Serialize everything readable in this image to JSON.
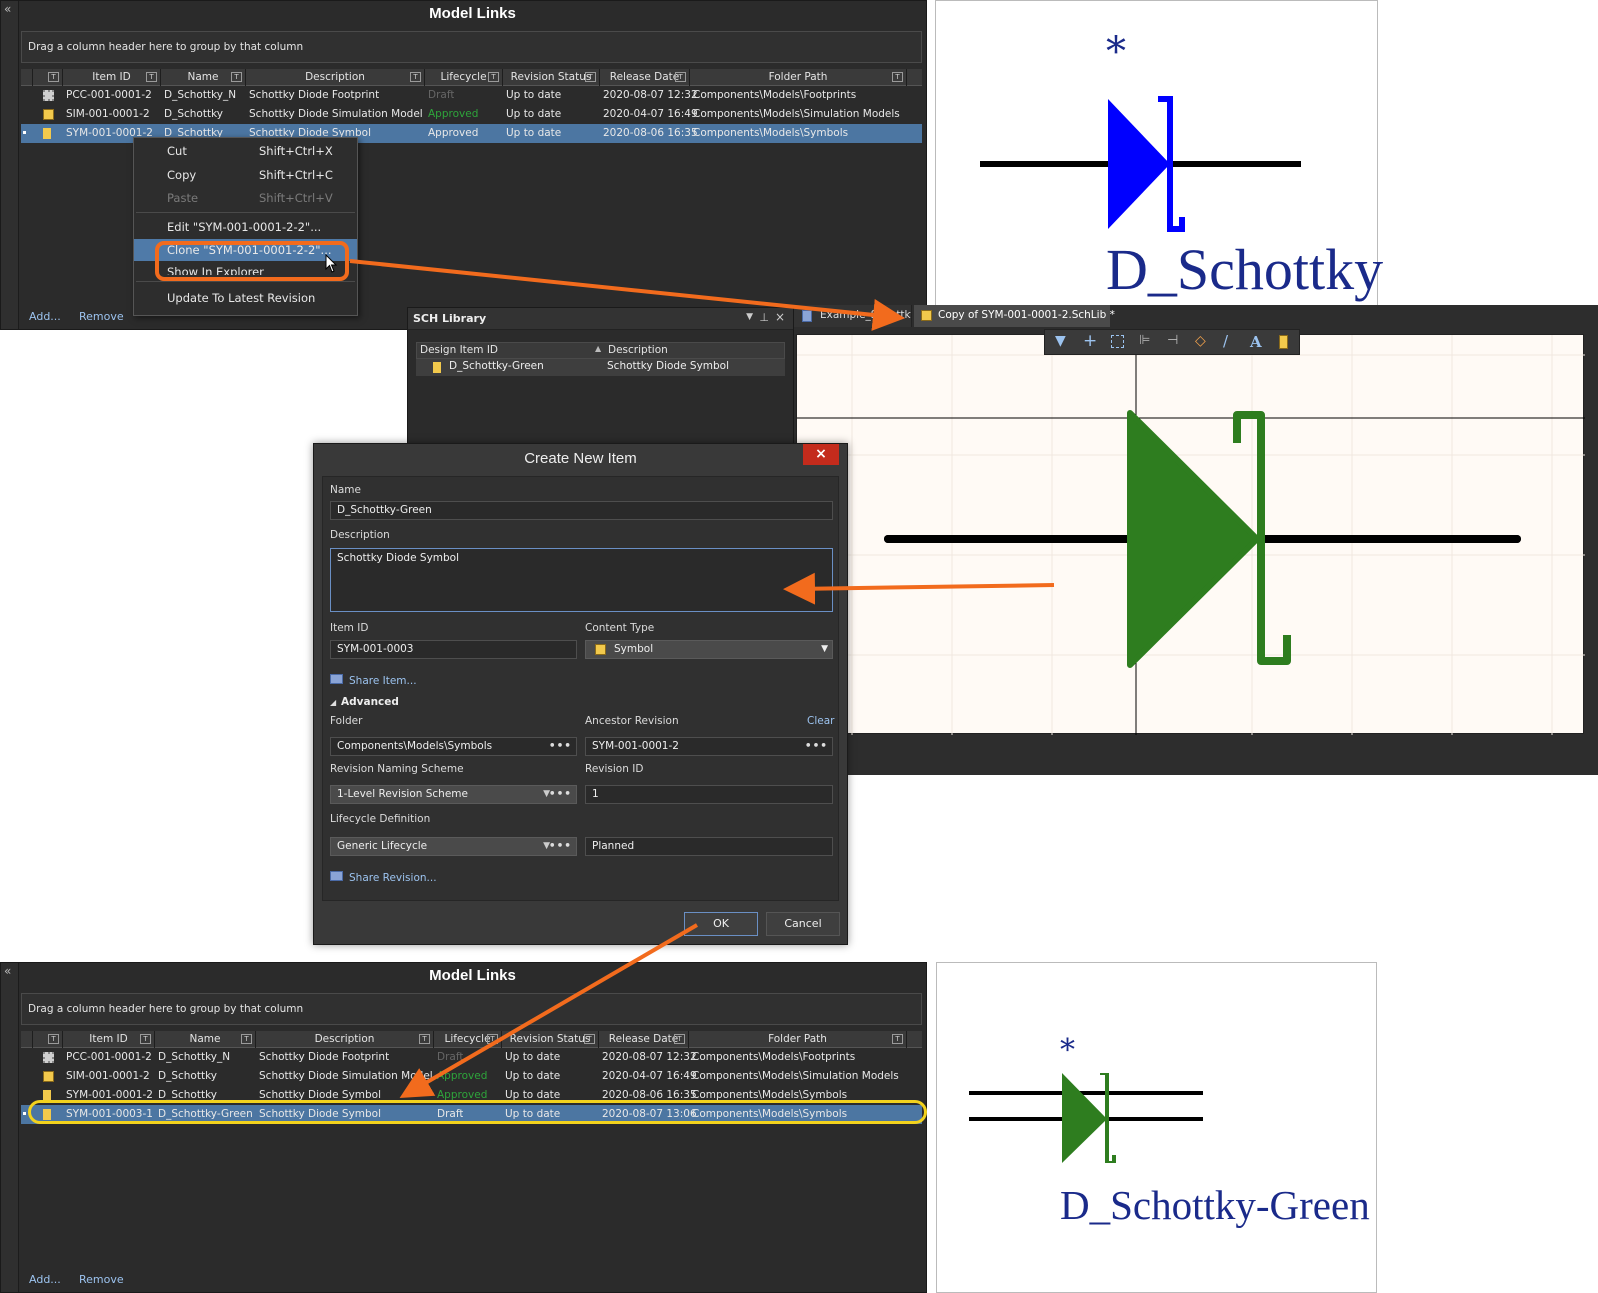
{
  "top_panel": {
    "title": "Model Links",
    "group_hint": "Drag a column header here to group by that column",
    "columns": [
      "Item ID",
      "Name",
      "Description",
      "Lifecycle",
      "Revision Status",
      "Release Date",
      "Folder Path"
    ],
    "rows": [
      {
        "icon": "footprint-icon",
        "item_id": "PCC-001-0001-2",
        "name": "D_Schottky_N",
        "description": "Schottky Diode Footprint",
        "lifecycle": "Draft",
        "revision_status": "Up to date",
        "release_date": "2020-08-07 12:32",
        "folder": "Components\\Models\\Footprints"
      },
      {
        "icon": "simulation-icon",
        "item_id": "SIM-001-0001-2",
        "name": "D_Schottky",
        "description": "Schottky Diode Simulation Model",
        "lifecycle": "Approved",
        "revision_status": "Up to date",
        "release_date": "2020-04-07 16:49",
        "folder": "Components\\Models\\Simulation Models"
      },
      {
        "icon": "symbol-icon",
        "item_id": "SYM-001-0001-2",
        "name": "D_Schottky",
        "description": "Schottky Diode Symbol",
        "lifecycle": "Approved",
        "revision_status": "Up to date",
        "release_date": "2020-08-06 16:35",
        "folder": "Components\\Models\\Symbols"
      }
    ],
    "add_label": "Add...",
    "remove_label": "Remove"
  },
  "context_menu": {
    "cut": "Cut",
    "cut_sc": "Shift+Ctrl+X",
    "copy": "Copy",
    "copy_sc": "Shift+Ctrl+C",
    "paste": "Paste",
    "paste_sc": "Shift+Ctrl+V",
    "edit": "Edit \"SYM-001-0001-2-2\"...",
    "clone": "Clone \"SYM-001-0001-2-2\"...",
    "show_explorer": "Show In Explorer",
    "update": "Update To Latest Revision"
  },
  "top_symbol": {
    "designator": "*",
    "name": "D_Schottky",
    "color": "#0000ff"
  },
  "sch_library": {
    "title": "SCH Library",
    "col_id": "Design Item ID",
    "col_desc": "Description",
    "item_id": "D_Schottky-Green",
    "item_desc": "Schottky Diode Symbol"
  },
  "editor": {
    "tab1": "Example_Schottky",
    "tab2": "Copy of SYM-001-0001-2.SchLib *",
    "symbol_color": "#2e7d1f"
  },
  "dialog": {
    "title": "Create New Item",
    "close": "×",
    "name_label": "Name",
    "name_value": "D_Schottky-Green",
    "desc_label": "Description",
    "desc_value": "Schottky Diode Symbol",
    "item_id_label": "Item ID",
    "item_id_value": "SYM-001-0003",
    "content_type_label": "Content Type",
    "content_type_value": "Symbol",
    "share_item": "Share Item...",
    "advanced": "Advanced",
    "folder_label": "Folder",
    "folder_value": "Components\\Models\\Symbols",
    "ancestor_label": "Ancestor Revision",
    "ancestor_value": "SYM-001-0001-2",
    "clear": "Clear",
    "naming_label": "Revision Naming Scheme",
    "naming_value": "1-Level Revision Scheme",
    "rev_id_label": "Revision ID",
    "rev_id_value": "1",
    "lifecycle_label": "Lifecycle Definition",
    "lifecycle_value": "Generic Lifecycle",
    "lifecycle_state": "Planned",
    "share_revision": "Share Revision...",
    "ok": "OK",
    "cancel": "Cancel"
  },
  "bottom_panel": {
    "title": "Model Links",
    "group_hint": "Drag a column header here to group by that column",
    "columns": [
      "Item ID",
      "Name",
      "Description",
      "Lifecycle",
      "Revision Status",
      "Release Date",
      "Folder Path"
    ],
    "rows": [
      {
        "icon": "footprint-icon",
        "item_id": "PCC-001-0001-2",
        "name": "D_Schottky_N",
        "description": "Schottky Diode Footprint",
        "lifecycle": "Draft",
        "revision_status": "Up to date",
        "release_date": "2020-08-07 12:32",
        "folder": "Components\\Models\\Footprints"
      },
      {
        "icon": "simulation-icon",
        "item_id": "SIM-001-0001-2",
        "name": "D_Schottky",
        "description": "Schottky Diode Simulation Model",
        "lifecycle": "Approved",
        "revision_status": "Up to date",
        "release_date": "2020-04-07 16:49",
        "folder": "Components\\Models\\Simulation Models"
      },
      {
        "icon": "symbol-icon",
        "item_id": "SYM-001-0001-2",
        "name": "D_Schottky",
        "description": "Schottky Diode Symbol",
        "lifecycle": "Approved",
        "revision_status": "Up to date",
        "release_date": "2020-08-06 16:35",
        "folder": "Components\\Models\\Symbols"
      },
      {
        "icon": "symbol-icon",
        "item_id": "SYM-001-0003-1",
        "name": "D_Schottky-Green",
        "description": "Schottky Diode Symbol",
        "lifecycle": "Draft",
        "revision_status": "Up to date",
        "release_date": "2020-08-07 13:06",
        "folder": "Components\\Models\\Symbols"
      }
    ],
    "add_label": "Add...",
    "remove_label": "Remove"
  },
  "bottom_symbol": {
    "designator": "*",
    "name": "D_Schottky-Green",
    "color": "#2e7d1f"
  },
  "colors": {
    "arrow": "#f26b1d",
    "highlight_ring": "#f2d21d",
    "selection": "#4c76a2",
    "close": "#c42b1c"
  }
}
